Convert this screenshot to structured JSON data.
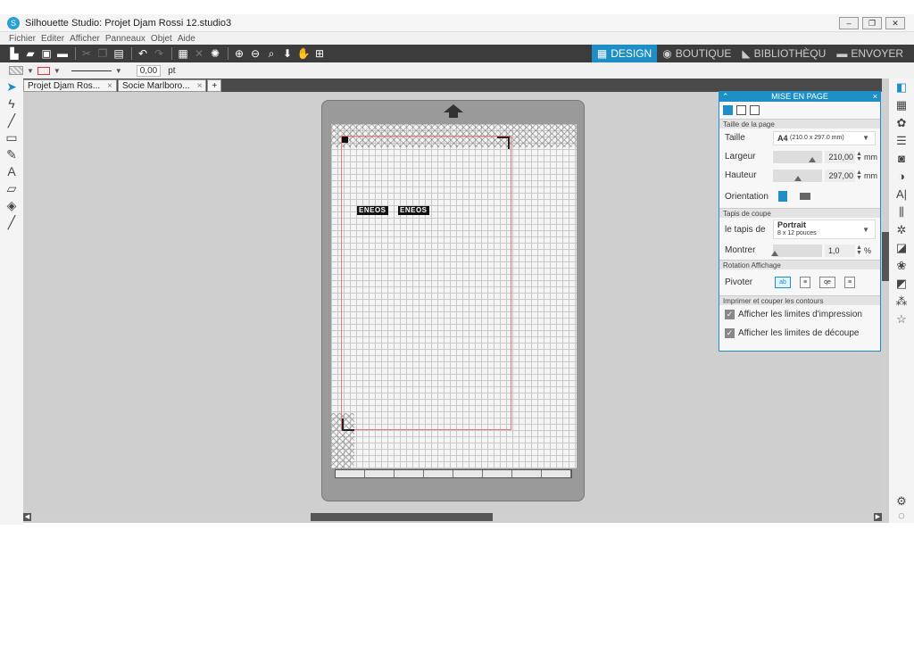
{
  "window": {
    "title": "Silhouette Studio: Projet Djam Rossi 12.studio3"
  },
  "menu": [
    "Fichier",
    "Editer",
    "Afficher",
    "Panneaux",
    "Objet",
    "Aide"
  ],
  "nav_tabs": {
    "design": "DESIGN",
    "boutique": "BOUTIQUE",
    "bibliotheque": "BIBLIOTHÈQU",
    "envoyer": "ENVOYER"
  },
  "linebar": {
    "width_value": "0,00",
    "unit": "pt"
  },
  "doc_tabs": [
    {
      "label": "Projet Djam Ros..."
    },
    {
      "label": "Socie Marlboro..."
    }
  ],
  "canvas": {
    "text1": "ENEOS",
    "text2": "ENEOS"
  },
  "panel": {
    "title": "MISE EN PAGE",
    "sec_page": "Taille de la page",
    "taille_label": "Taille",
    "taille_value": "A4",
    "taille_detail": "(210.0 x 297.0 mm)",
    "largeur_label": "Largeur",
    "largeur_value": "210,00",
    "hauteur_label": "Hauteur",
    "hauteur_value": "297,00",
    "mm": "mm",
    "orientation_label": "Orientation",
    "sec_tapis": "Tapis de coupe",
    "tapis_label": "le tapis de",
    "tapis_value": "Portrait",
    "tapis_detail": "8 x 12 pouces",
    "montrer_label": "Montrer",
    "montrer_value": "1,0",
    "pct": "%",
    "sec_rotation": "Rotation Affichage",
    "pivoter_label": "Pivoter",
    "sec_imprimer": "Imprimer et couper les contours",
    "chk1": "Afficher les limites d'impression",
    "chk2": "Afficher les limites de découpe"
  }
}
